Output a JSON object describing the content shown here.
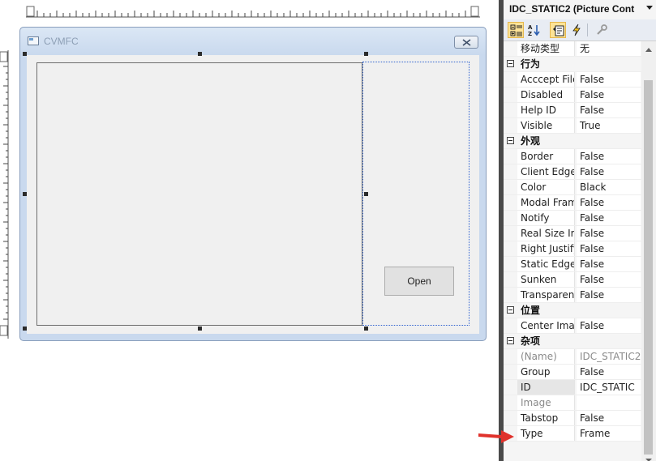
{
  "dialog": {
    "title": "CVMFC",
    "open_button": "Open"
  },
  "properties": {
    "header": "IDC_STATIC2 (Picture Cont",
    "rows": [
      {
        "kind": "prop",
        "name": "移动类型",
        "value": "无"
      },
      {
        "kind": "cat",
        "name": "行为"
      },
      {
        "kind": "prop",
        "name": "Acccept Files",
        "value": "False"
      },
      {
        "kind": "prop",
        "name": "Disabled",
        "value": "False"
      },
      {
        "kind": "prop",
        "name": "Help ID",
        "value": "False"
      },
      {
        "kind": "prop",
        "name": "Visible",
        "value": "True"
      },
      {
        "kind": "cat",
        "name": "外观"
      },
      {
        "kind": "prop",
        "name": "Border",
        "value": "False"
      },
      {
        "kind": "prop",
        "name": "Client Edge",
        "value": "False"
      },
      {
        "kind": "prop",
        "name": "Color",
        "value": "Black"
      },
      {
        "kind": "prop",
        "name": "Modal Frame",
        "value": "False"
      },
      {
        "kind": "prop",
        "name": "Notify",
        "value": "False"
      },
      {
        "kind": "prop",
        "name": "Real Size Image",
        "value": "False"
      },
      {
        "kind": "prop",
        "name": "Right Justify",
        "value": "False"
      },
      {
        "kind": "prop",
        "name": "Static Edge",
        "value": "False"
      },
      {
        "kind": "prop",
        "name": "Sunken",
        "value": "False"
      },
      {
        "kind": "prop",
        "name": "Transparent",
        "value": "False"
      },
      {
        "kind": "cat",
        "name": "位置"
      },
      {
        "kind": "prop",
        "name": "Center Image",
        "value": "False"
      },
      {
        "kind": "cat",
        "name": "杂项"
      },
      {
        "kind": "prop",
        "name": "(Name)",
        "value": "IDC_STATIC2",
        "gray": true
      },
      {
        "kind": "prop",
        "name": "Group",
        "value": "False"
      },
      {
        "kind": "prop",
        "name": "ID",
        "value": "IDC_STATIC",
        "highlight": true
      },
      {
        "kind": "prop",
        "name": "Image",
        "value": "",
        "gray": true
      },
      {
        "kind": "prop",
        "name": "Tabstop",
        "value": "False"
      },
      {
        "kind": "prop",
        "name": "Type",
        "value": "Frame"
      }
    ]
  },
  "colors": {
    "annotation_arrow": "#e0322c",
    "selection": "#3264d0",
    "toolbar_active": "#fde396"
  }
}
